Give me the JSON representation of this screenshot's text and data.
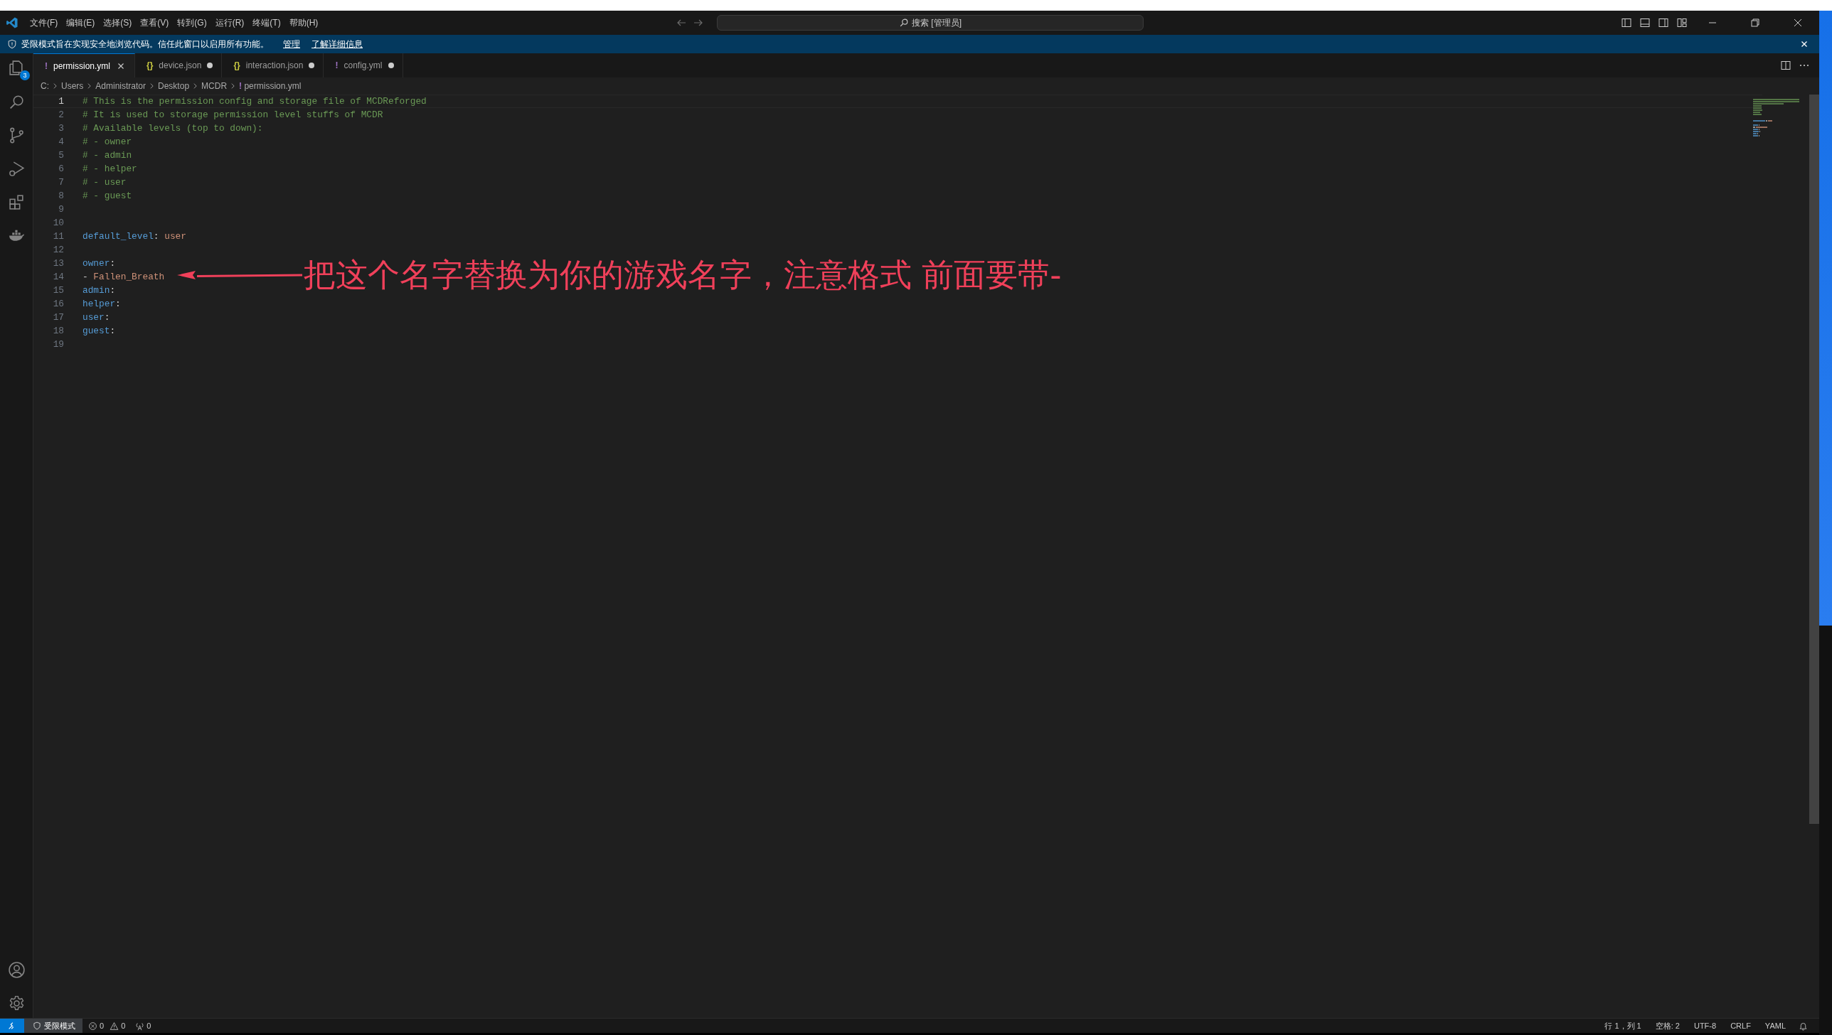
{
  "title_bar": {
    "menu": [
      "文件(F)",
      "编辑(E)",
      "选择(S)",
      "查看(V)",
      "转到(G)",
      "运行(R)",
      "终端(T)",
      "帮助(H)"
    ],
    "search": {
      "placeholder": "搜索 [管理员]"
    }
  },
  "banner": {
    "message": "受限模式旨在实现安全地浏览代码。信任此窗口以启用所有功能。",
    "links": [
      "管理",
      "了解详细信息"
    ]
  },
  "activity_bar": {
    "explorer_badge": "3"
  },
  "tabs": [
    {
      "icon": "!",
      "kind": "yaml",
      "label": "permission.yml",
      "selected": true,
      "modified": false
    },
    {
      "icon": "{}",
      "kind": "json",
      "label": "device.json",
      "selected": false,
      "modified": true
    },
    {
      "icon": "{}",
      "kind": "json",
      "label": "interaction.json",
      "selected": false,
      "modified": true
    },
    {
      "icon": "!",
      "kind": "yaml",
      "label": "config.yml",
      "selected": false,
      "modified": true
    }
  ],
  "breadcrumb": {
    "path": [
      "C:",
      "Users",
      "Administrator",
      "Desktop",
      "MCDR"
    ],
    "file": {
      "icon": "!",
      "kind": "yaml",
      "label": "permission.yml"
    }
  },
  "editor": {
    "lines": [
      {
        "number": "1",
        "current": true,
        "tokens": [
          {
            "kind": "comment",
            "text": "# This is the permission config and storage file of MCDReforged"
          }
        ]
      },
      {
        "number": "2",
        "current": false,
        "tokens": [
          {
            "kind": "comment",
            "text": "# It is used to storage permission level stuffs of MCDR"
          }
        ]
      },
      {
        "number": "3",
        "current": false,
        "tokens": [
          {
            "kind": "comment",
            "text": "# Available levels (top to down):"
          }
        ]
      },
      {
        "number": "4",
        "current": false,
        "tokens": [
          {
            "kind": "comment",
            "text": "# - owner"
          }
        ]
      },
      {
        "number": "5",
        "current": false,
        "tokens": [
          {
            "kind": "comment",
            "text": "# - admin"
          }
        ]
      },
      {
        "number": "6",
        "current": false,
        "tokens": [
          {
            "kind": "comment",
            "text": "# - helper"
          }
        ]
      },
      {
        "number": "7",
        "current": false,
        "tokens": [
          {
            "kind": "comment",
            "text": "# - user"
          }
        ]
      },
      {
        "number": "8",
        "current": false,
        "tokens": [
          {
            "kind": "comment",
            "text": "# - guest"
          }
        ]
      },
      {
        "number": "9",
        "current": false
      },
      {
        "number": "10",
        "current": false
      },
      {
        "number": "11",
        "current": false,
        "tokens": [
          {
            "kind": "key",
            "text": "default_level"
          },
          {
            "kind": "punct",
            "text": ": "
          },
          {
            "kind": "value",
            "text": "user"
          }
        ]
      },
      {
        "number": "12",
        "current": false
      },
      {
        "number": "13",
        "current": false,
        "tokens": [
          {
            "kind": "key",
            "text": "owner"
          },
          {
            "kind": "punct",
            "text": ":"
          }
        ]
      },
      {
        "number": "14",
        "current": false,
        "tokens": [
          {
            "kind": "punct",
            "text": "- "
          },
          {
            "kind": "value",
            "text": "Fallen_Breath"
          }
        ]
      },
      {
        "number": "15",
        "current": false,
        "tokens": [
          {
            "kind": "key",
            "text": "admin"
          },
          {
            "kind": "punct",
            "text": ":"
          }
        ]
      },
      {
        "number": "16",
        "current": false,
        "tokens": [
          {
            "kind": "key",
            "text": "helper"
          },
          {
            "kind": "punct",
            "text": ":"
          }
        ]
      },
      {
        "number": "17",
        "current": false,
        "tokens": [
          {
            "kind": "key",
            "text": "user"
          },
          {
            "kind": "punct",
            "text": ":"
          }
        ]
      },
      {
        "number": "18",
        "current": false,
        "tokens": [
          {
            "kind": "key",
            "text": "guest"
          },
          {
            "kind": "punct",
            "text": ":"
          }
        ]
      },
      {
        "number": "19",
        "current": false
      }
    ]
  },
  "annotation": {
    "text": "把这个名字替换为你的游戏名字，注意格式 前面要带-"
  },
  "status_bar": {
    "restricted_mode": "受限模式",
    "errors": "0",
    "warnings": "0",
    "ports": "0",
    "position": "行 1，列 1",
    "indent": "空格: 2",
    "encoding": "UTF-8",
    "eol": "CRLF",
    "language": "YAML"
  }
}
